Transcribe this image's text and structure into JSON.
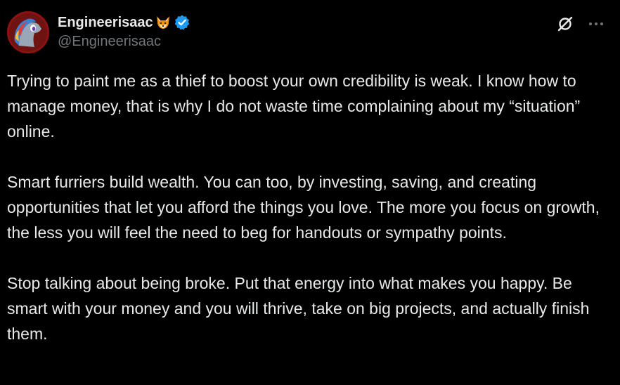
{
  "author": {
    "display_name": "Engineerisaac",
    "name_emoji": "fox-face-icon",
    "verified": true,
    "verified_color": "#1d9bf0",
    "handle": "@Engineerisaac",
    "avatar_icon": "pony-avatar"
  },
  "actions": {
    "grok_icon": "grok-icon",
    "more_icon": "more-icon"
  },
  "tweet": {
    "paragraphs": [
      "Trying to paint me as a thief to boost your own credibility is weak. I know how to manage money, that is why I do not waste time complaining about my “situation” online.",
      "Smart furriers build wealth. You can too, by investing, saving, and creating opportunities that let you afford the things you love. The more you focus on growth, the less you will feel the need to beg for handouts or sympathy points.",
      "Stop talking about being broke. Put that energy into what makes you happy. Be smart with your money and you will thrive, take on big projects, and actually finish them."
    ]
  },
  "colors": {
    "background": "#000000",
    "text_primary": "#e7e9ea",
    "text_secondary": "#71767b",
    "accent": "#1d9bf0"
  }
}
